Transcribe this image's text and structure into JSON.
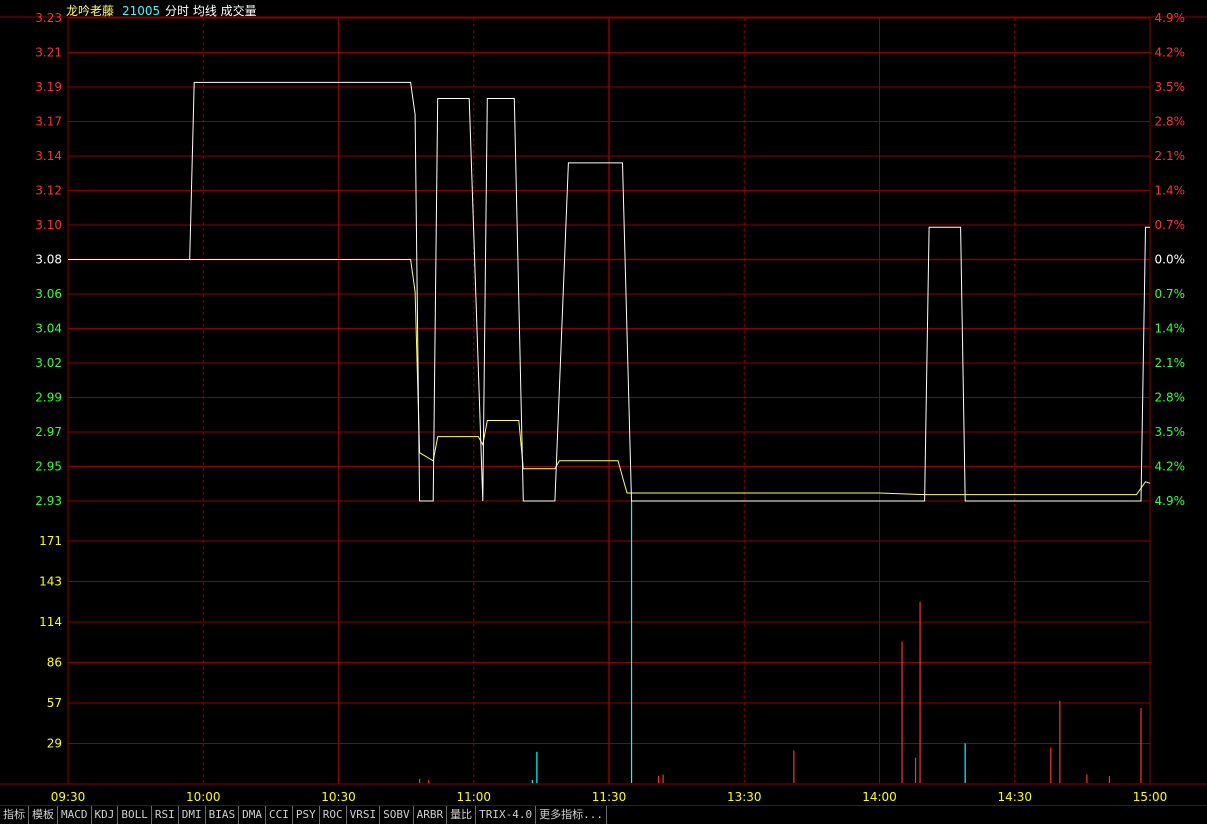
{
  "header": {
    "stock_name": "龙吟老藤",
    "code": "21005",
    "indicators": "分时 均线 成交量"
  },
  "colors": {
    "background": "#000000",
    "grid": "#8b0000",
    "up": "#ff3030",
    "down": "#33ff33",
    "neutral": "#ffffff",
    "price_line": "#ffffff",
    "avg_line": "#ffff66",
    "volume_up": "#ff3030",
    "volume_down": "#00ffff",
    "volume_axis": "#ffff00",
    "time_axis": "#ffff00"
  },
  "chart_data": {
    "type": "line",
    "prev_close": 3.08,
    "price_ticks": [
      "3.23",
      "3.21",
      "3.19",
      "3.17",
      "3.14",
      "3.12",
      "3.10",
      "3.08",
      "3.06",
      "3.04",
      "3.02",
      "2.99",
      "2.97",
      "2.95",
      "2.93"
    ],
    "pct_ticks": [
      "4.9%",
      "4.2%",
      "3.5%",
      "2.8%",
      "2.1%",
      "1.4%",
      "0.7%",
      "0.0%",
      "0.7%",
      "1.4%",
      "2.1%",
      "2.8%",
      "3.5%",
      "4.2%",
      "4.9%"
    ],
    "volume_ticks": [
      "171",
      "143",
      "114",
      "86",
      "57",
      "29"
    ],
    "time_ticks": [
      "09:30",
      "10:00",
      "10:30",
      "11:00",
      "11:30",
      "13:30",
      "14:00",
      "14:30",
      "15:00"
    ],
    "ylim": [
      2.93,
      3.23
    ],
    "volume_max": 200,
    "price_series": [
      [
        0,
        3.08
      ],
      [
        27,
        3.08
      ],
      [
        28,
        3.19
      ],
      [
        76,
        3.19
      ],
      [
        77,
        3.17
      ],
      [
        78,
        2.93
      ],
      [
        81,
        2.93
      ],
      [
        82,
        3.18
      ],
      [
        89,
        3.18
      ],
      [
        92,
        2.93
      ],
      [
        93,
        3.18
      ],
      [
        99,
        3.18
      ],
      [
        101,
        2.93
      ],
      [
        108,
        2.93
      ],
      [
        111,
        3.14
      ],
      [
        123,
        3.14
      ],
      [
        125,
        2.93
      ],
      [
        180,
        2.93
      ],
      [
        190,
        2.93
      ],
      [
        191,
        3.1
      ],
      [
        198,
        3.1
      ],
      [
        199,
        2.93
      ],
      [
        235,
        2.93
      ],
      [
        238,
        2.93
      ],
      [
        239,
        3.1
      ],
      [
        240,
        3.1
      ]
    ],
    "avg_series": [
      [
        0,
        3.08
      ],
      [
        27,
        3.08
      ],
      [
        76,
        3.08
      ],
      [
        77,
        3.06
      ],
      [
        78,
        2.96
      ],
      [
        81,
        2.955
      ],
      [
        82,
        2.97
      ],
      [
        91,
        2.97
      ],
      [
        92,
        2.965
      ],
      [
        93,
        2.98
      ],
      [
        100,
        2.98
      ],
      [
        101,
        2.95
      ],
      [
        108,
        2.95
      ],
      [
        109,
        2.955
      ],
      [
        122,
        2.955
      ],
      [
        124,
        2.935
      ],
      [
        180,
        2.935
      ],
      [
        190,
        2.934
      ],
      [
        199,
        2.934
      ],
      [
        237,
        2.934
      ],
      [
        239,
        2.942
      ],
      [
        240,
        2.941
      ]
    ],
    "volume_bars": [
      {
        "t": 78,
        "v": 3,
        "dir": "up"
      },
      {
        "t": 80,
        "v": 2,
        "dir": "up"
      },
      {
        "t": 103,
        "v": 2,
        "dir": "down"
      },
      {
        "t": 104,
        "v": 22,
        "dir": "down"
      },
      {
        "t": 125,
        "v": 200,
        "dir": "down"
      },
      {
        "t": 131,
        "v": 5,
        "dir": "up"
      },
      {
        "t": 132,
        "v": 6,
        "dir": "up"
      },
      {
        "t": 161,
        "v": 23,
        "dir": "up"
      },
      {
        "t": 185,
        "v": 100,
        "dir": "up"
      },
      {
        "t": 188,
        "v": 18,
        "dir": "up"
      },
      {
        "t": 189,
        "v": 128,
        "dir": "up"
      },
      {
        "t": 199,
        "v": 28,
        "dir": "down"
      },
      {
        "t": 218,
        "v": 25,
        "dir": "up"
      },
      {
        "t": 220,
        "v": 58,
        "dir": "up"
      },
      {
        "t": 226,
        "v": 6,
        "dir": "up"
      },
      {
        "t": 231,
        "v": 5,
        "dir": "up"
      },
      {
        "t": 238,
        "v": 53,
        "dir": "up"
      }
    ]
  },
  "tabs": [
    "指标",
    "模板",
    "MACD",
    "KDJ",
    "BOLL",
    "RSI",
    "DMI",
    "BIAS",
    "DMA",
    "CCI",
    "PSY",
    "ROC",
    "VRSI",
    "SOBV",
    "ARBR",
    "量比",
    "TRIX-4.0",
    "更多指标..."
  ]
}
